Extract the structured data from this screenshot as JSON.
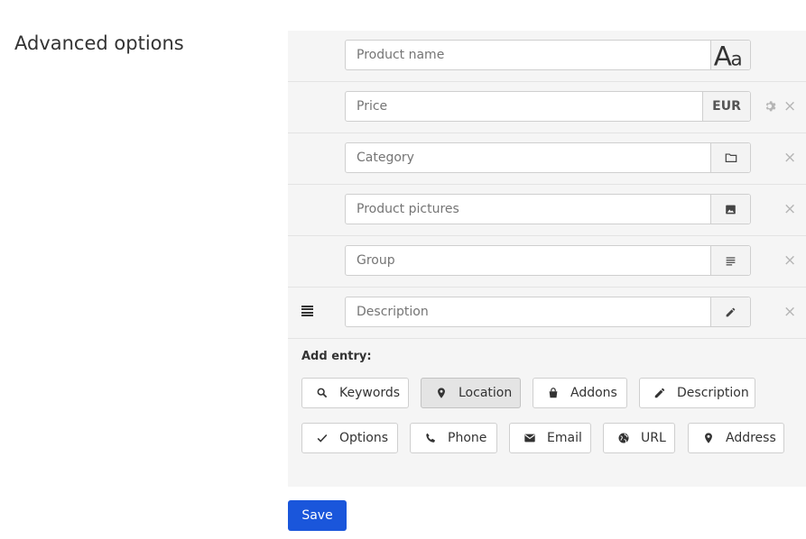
{
  "section": {
    "title": "Advanced options"
  },
  "fields": [
    {
      "placeholder": "Product name",
      "addon_icon": "text-format-icon",
      "removable": false
    },
    {
      "placeholder": "Price",
      "addon_text": "EUR",
      "has_settings": true,
      "removable": true
    },
    {
      "placeholder": "Category",
      "addon_icon": "folder-icon",
      "removable": true
    },
    {
      "placeholder": "Product pictures",
      "addon_icon": "image-icon",
      "removable": true
    },
    {
      "placeholder": "Group",
      "addon_icon": "lines-icon",
      "removable": true
    },
    {
      "placeholder": "Description",
      "addon_icon": "pencil-icon",
      "removable": true,
      "draggable": true
    }
  ],
  "remove_symbol": "×",
  "add_entry": {
    "label": "Add entry:",
    "buttons": [
      {
        "label": "Keywords",
        "icon": "search-icon"
      },
      {
        "label": "Location",
        "icon": "map-pin-icon",
        "active": true
      },
      {
        "label": "Addons",
        "icon": "shopping-bag-icon"
      },
      {
        "label": "Description",
        "icon": "pencil-icon"
      },
      {
        "label": "Options",
        "icon": "checkmark-icon"
      },
      {
        "label": "Phone",
        "icon": "phone-icon"
      },
      {
        "label": "Email",
        "icon": "envelope-icon"
      },
      {
        "label": "URL",
        "icon": "globe-icon"
      },
      {
        "label": "Address",
        "icon": "map-pin-icon"
      }
    ]
  },
  "save": {
    "label": "Save"
  },
  "colors": {
    "primary": "#1a56db",
    "panel": "#f5f5f5",
    "border": "#cfcfcf"
  }
}
